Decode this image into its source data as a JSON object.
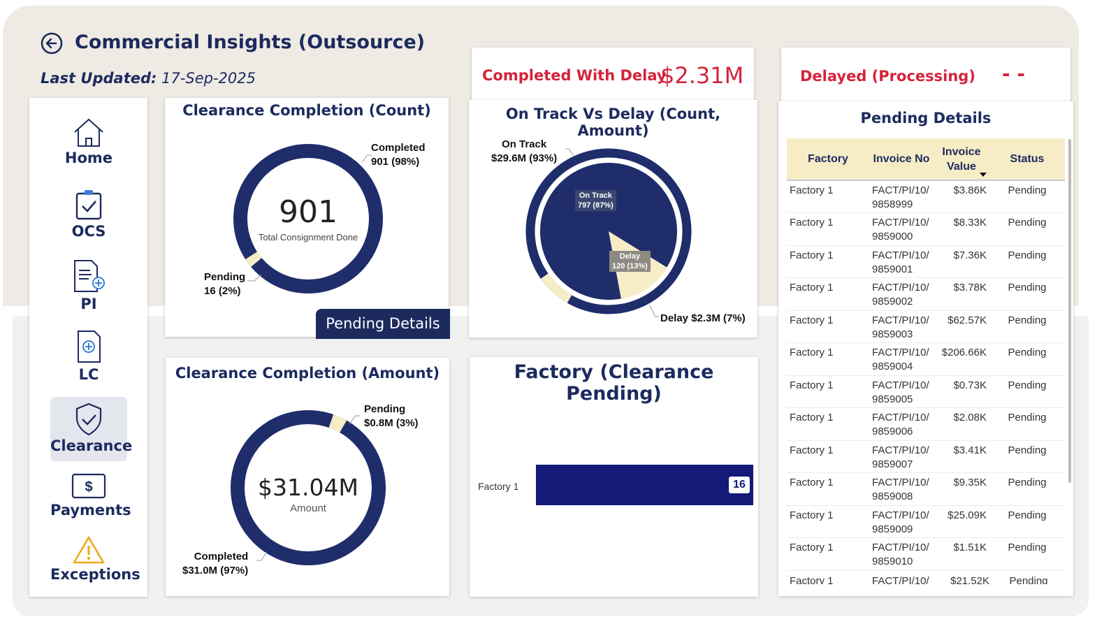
{
  "header": {
    "title": "Commercial Insights (Outsource)",
    "updated_label": "Last Updated:",
    "updated_value": "17-Sep-2025"
  },
  "sidebar": {
    "items": [
      {
        "label": "Home",
        "icon": "home-icon"
      },
      {
        "label": "OCS",
        "icon": "clipboard-check-icon"
      },
      {
        "label": "PI",
        "icon": "document-add-icon"
      },
      {
        "label": "LC",
        "icon": "document-plus-icon"
      },
      {
        "label": "Clearance",
        "icon": "shield-check-icon",
        "active": true
      },
      {
        "label": "Payments",
        "icon": "dollar-bill-icon"
      },
      {
        "label": "Exceptions",
        "icon": "warning-icon"
      }
    ]
  },
  "kpis": {
    "completed_delay_label": "Completed With Delay",
    "completed_delay_value": "$2.31M",
    "delayed_processing_label": "Delayed (Processing)",
    "delayed_processing_value": "- -"
  },
  "count_card": {
    "title": "Clearance Completion (Count)",
    "center_value": "901",
    "center_caption": "Total Consignment Done",
    "completed_label_1": "Completed",
    "completed_label_2": "901 (98%)",
    "pending_label_1": "Pending",
    "pending_label_2": "16 (2%)",
    "button_label": "Pending Details"
  },
  "amount_card": {
    "title": "Clearance Completion (Amount)",
    "center_value": "$31.04M",
    "center_caption": "Amount",
    "pending_label_1": "Pending",
    "pending_label_2": "$0.8M (3%)",
    "completed_label_1": "Completed",
    "completed_label_2": "$31.0M (97%)"
  },
  "ontrack_card": {
    "title": "On Track Vs Delay (Count, Amount)",
    "outer_ontrack_1": "On Track",
    "outer_ontrack_2": "$29.6M (93%)",
    "outer_delay": "Delay $2.3M (7%)",
    "inner_ontrack_1": "On Track",
    "inner_ontrack_2": "797 (87%)",
    "inner_delay_1": "Delay",
    "inner_delay_2": "120 (13%)"
  },
  "factory_card": {
    "title": "Factory (Clearance Pending)",
    "bar_label": "Factory 1",
    "bar_value": "16"
  },
  "pending_details": {
    "title": "Pending Details",
    "columns": [
      "Factory",
      "Invoice No",
      "Invoice Value",
      "Status"
    ],
    "rows": [
      {
        "factory": "Factory 1",
        "invoice_a": "FACT/PI/10/",
        "invoice_b": "9858999",
        "value": "$3.86K",
        "status": "Pending"
      },
      {
        "factory": "Factory 1",
        "invoice_a": "FACT/PI/10/",
        "invoice_b": "9859000",
        "value": "$8.33K",
        "status": "Pending"
      },
      {
        "factory": "Factory 1",
        "invoice_a": "FACT/PI/10/",
        "invoice_b": "9859001",
        "value": "$7.36K",
        "status": "Pending"
      },
      {
        "factory": "Factory 1",
        "invoice_a": "FACT/PI/10/",
        "invoice_b": "9859002",
        "value": "$3.78K",
        "status": "Pending"
      },
      {
        "factory": "Factory 1",
        "invoice_a": "FACT/PI/10/",
        "invoice_b": "9859003",
        "value": "$62.57K",
        "status": "Pending"
      },
      {
        "factory": "Factory 1",
        "invoice_a": "FACT/PI/10/",
        "invoice_b": "9859004",
        "value": "$206.66K",
        "status": "Pending"
      },
      {
        "factory": "Factory 1",
        "invoice_a": "FACT/PI/10/",
        "invoice_b": "9859005",
        "value": "$0.73K",
        "status": "Pending"
      },
      {
        "factory": "Factory 1",
        "invoice_a": "FACT/PI/10/",
        "invoice_b": "9859006",
        "value": "$2.08K",
        "status": "Pending"
      },
      {
        "factory": "Factory 1",
        "invoice_a": "FACT/PI/10/",
        "invoice_b": "9859007",
        "value": "$3.41K",
        "status": "Pending"
      },
      {
        "factory": "Factory 1",
        "invoice_a": "FACT/PI/10/",
        "invoice_b": "9859008",
        "value": "$9.35K",
        "status": "Pending"
      },
      {
        "factory": "Factory 1",
        "invoice_a": "FACT/PI/10/",
        "invoice_b": "9859009",
        "value": "$25.09K",
        "status": "Pending"
      },
      {
        "factory": "Factory 1",
        "invoice_a": "FACT/PI/10/",
        "invoice_b": "9859010",
        "value": "$1.51K",
        "status": "Pending"
      },
      {
        "factory": "Factory 1",
        "invoice_a": "FACT/PI/10/",
        "invoice_b": "",
        "value": "$21.52K",
        "status": "Pending"
      }
    ]
  },
  "colors": {
    "navy": "#1c2a5e",
    "ring_navy": "#1f2d6b",
    "bar_navy": "#141a78",
    "cream": "#f6edc7",
    "accent_red": "#d3243b"
  },
  "chart_data": [
    {
      "type": "pie",
      "title": "Clearance Completion (Count)",
      "labels": [
        "Completed",
        "Pending"
      ],
      "values": [
        901,
        16
      ],
      "percentages": [
        98,
        2
      ]
    },
    {
      "type": "pie",
      "title": "Clearance Completion (Amount)",
      "labels": [
        "Completed",
        "Pending"
      ],
      "values": [
        31.0,
        0.8
      ],
      "percentages": [
        97,
        3
      ],
      "unit": "$M"
    },
    {
      "type": "pie",
      "title": "On Track Vs Delay (Count, Amount)",
      "series": [
        {
          "name": "Count",
          "labels": [
            "On Track",
            "Delay"
          ],
          "values": [
            797,
            120
          ],
          "percentages": [
            87,
            13
          ]
        },
        {
          "name": "Amount",
          "labels": [
            "On Track",
            "Delay"
          ],
          "values": [
            29.6,
            2.3
          ],
          "percentages": [
            93,
            7
          ]
        }
      ]
    },
    {
      "type": "bar",
      "title": "Factory (Clearance Pending)",
      "categories": [
        "Factory 1"
      ],
      "values": [
        16
      ]
    }
  ]
}
